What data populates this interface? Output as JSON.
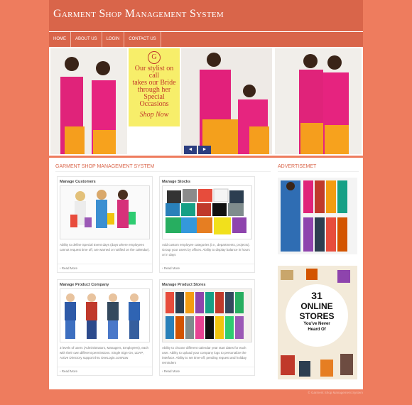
{
  "site": {
    "title": "Garment Shop Management System"
  },
  "nav": [
    "HOME",
    "ABOUT US",
    "LOGIN",
    "CONTACT US"
  ],
  "promo": {
    "logo": "G",
    "lines": [
      "Our stylist on",
      "call",
      "takes our Bride",
      "through her",
      "Special Occasions"
    ],
    "cta": "Shop Now"
  },
  "slider_controls": {
    "prev": "◄",
    "next": "►"
  },
  "main": {
    "section_title": "GARMENT SHOP MANAGEMENT SYSTEM",
    "cards": [
      {
        "title": "Manage Customers",
        "text": "Ability to define Special Event days (days where employees cannot request time off, are warned or notified on the calendar).",
        "more": "Read More"
      },
      {
        "title": "Manage Stocks",
        "text": "Add custom employee categories (i.e., departments, projects). Group your users by offices. Ability to display balance in hours or in days",
        "more": "Read More"
      },
      {
        "title": "Manage Product Company",
        "text": "3 levels of users (Administrators, Managers, Employees), each with their own different permissions. Single Sign-On, LDAP, Active Directory support thru OneLogin.comNow",
        "more": "Read More"
      },
      {
        "title": "Manage Product Stores",
        "text": "Ability to choose different calendar year start dates for each user. Ability to upload your company logo to personalize the interface. Ability to set time-off, pending request and holiday reminders",
        "more": "Read More"
      }
    ]
  },
  "ads": {
    "title": "ADVERTISEMET",
    "banner": {
      "number": "31",
      "line1": "ONLINE",
      "line2": "STORES",
      "line3": "You've Never",
      "line4": "Heard Of"
    }
  },
  "footer": "© Garment Shop Management System",
  "colors": {
    "background": "#ee7c5e",
    "header": "#d9654a",
    "accent": "#d9654a"
  }
}
